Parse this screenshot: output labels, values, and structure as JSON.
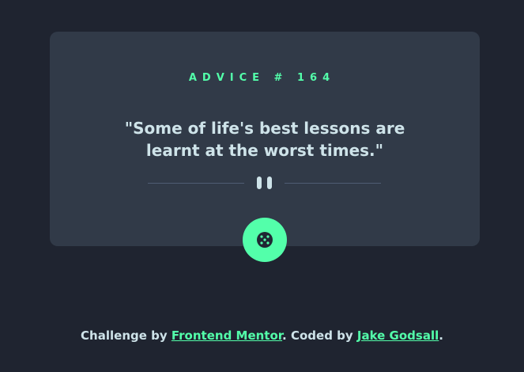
{
  "card": {
    "advice_label": "ADVICE # 164",
    "quote": "\"Some of life's best lessons are learnt at the worst times.\""
  },
  "icons": {
    "divider": "pause-icon",
    "button": "dice-icon"
  },
  "footer": {
    "prefix": "Challenge by ",
    "link1": "Frontend Mentor",
    "middle": ". Coded by ",
    "link2": "Jake Godsall",
    "suffix": "."
  },
  "colors": {
    "background": "#1f2430",
    "card": "#313a48",
    "accent": "#53ffaa",
    "text": "#cee3e9",
    "divider": "#4f5d74"
  }
}
